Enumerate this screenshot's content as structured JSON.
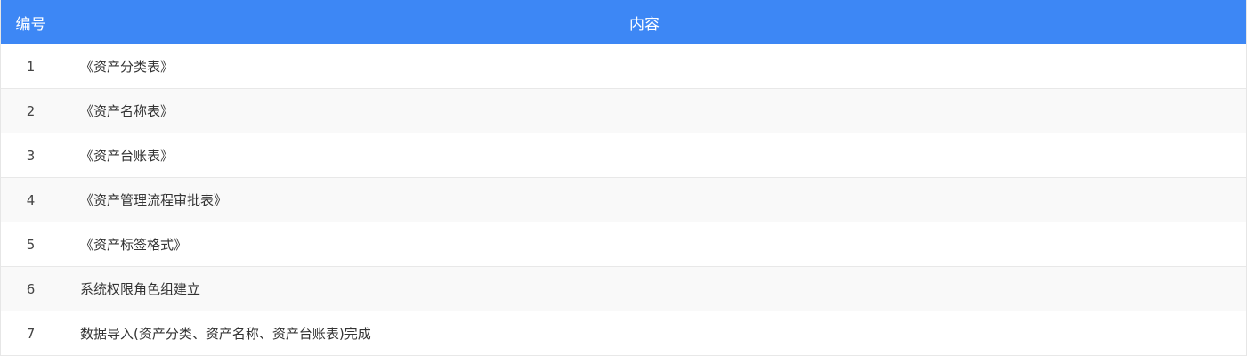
{
  "table": {
    "header": {
      "num_label": "编号",
      "content_label": "内容"
    },
    "rows": [
      {
        "num": "1",
        "content": "《资产分类表》"
      },
      {
        "num": "2",
        "content": "《资产名称表》"
      },
      {
        "num": "3",
        "content": "《资产台账表》"
      },
      {
        "num": "4",
        "content": "《资产管理流程审批表》"
      },
      {
        "num": "5",
        "content": "《资产标签格式》"
      },
      {
        "num": "6",
        "content": "系统权限角色组建立"
      },
      {
        "num": "7",
        "content": "数据导入(资产分类、资产名称、资产台账表)完成"
      }
    ]
  },
  "colors": {
    "header_bg": "#3d87f5",
    "header_text": "#ffffff",
    "row_alt_bg": "#f9f9f9",
    "border": "#e8e8e8"
  }
}
